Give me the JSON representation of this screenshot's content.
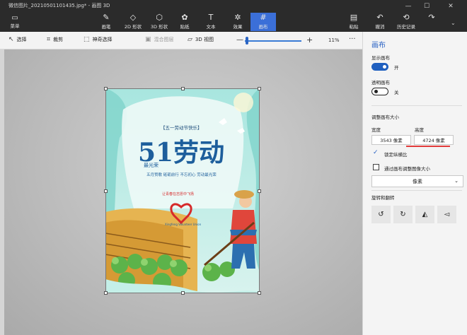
{
  "window": {
    "title": "微信图片_20210501101435.jpg* - 画图 3D",
    "controls": {
      "minimize": "—",
      "maximize": "☐",
      "close": "✕"
    }
  },
  "ribbon": {
    "menu_label": "菜单",
    "tools": [
      {
        "label": "画笔",
        "icon": "brush-icon",
        "glyph": "✎"
      },
      {
        "label": "2D 形状",
        "icon": "shapes-2d-icon",
        "glyph": "◇"
      },
      {
        "label": "3D 形状",
        "icon": "cube-3d-icon",
        "glyph": "⬡"
      },
      {
        "label": "贴纸",
        "icon": "sticker-icon",
        "glyph": "✿"
      },
      {
        "label": "文本",
        "icon": "text-icon",
        "glyph": "T"
      },
      {
        "label": "效果",
        "icon": "effects-icon",
        "glyph": "✲"
      },
      {
        "label": "画布",
        "icon": "canvas-icon",
        "glyph": "#"
      }
    ],
    "right_tools": [
      {
        "label": "粘贴",
        "icon": "paste-icon",
        "glyph": "▤"
      },
      {
        "label": "撤消",
        "icon": "undo-icon",
        "glyph": "↶"
      },
      {
        "label": "历史记录",
        "icon": "history-icon",
        "glyph": "⟲"
      },
      {
        "label": "",
        "icon": "redo-icon",
        "glyph": "↷"
      }
    ],
    "active_tool": "画布",
    "accent_color": "#3b6fd8"
  },
  "subtoolbar": {
    "select_label": "选择",
    "crop_label": "裁剪",
    "magic_select_label": "神奇选择",
    "merge_label": "混合图层",
    "view3d_label": "3D 视图",
    "zoom_value": "11%",
    "more_label": "···"
  },
  "poster": {
    "banner": "【五一劳动节快乐】",
    "headline": "51劳动",
    "subhead": "最光荣",
    "tagline": "五月赞歌 砥砺前行 不忘初心 劳动最光荣",
    "arc_text": "让青春在志愿中飞扬",
    "logo_caption": "Xingfeng  Volunteer  Union"
  },
  "panel": {
    "title": "画布",
    "show_canvas_label": "显示画布",
    "show_canvas_state": "开",
    "transparent_label": "透明画布",
    "transparent_state": "关",
    "resize_label": "调整画布大小",
    "width_label": "宽度",
    "height_label": "高度",
    "width_value": "3543 像素",
    "height_value": "4724 像素",
    "lock_ratio_label": "锁定纵横比",
    "resize_image_label": "通过画布调整图像大小",
    "unit_value": "像素",
    "rotate_label": "旋转和翻转"
  }
}
